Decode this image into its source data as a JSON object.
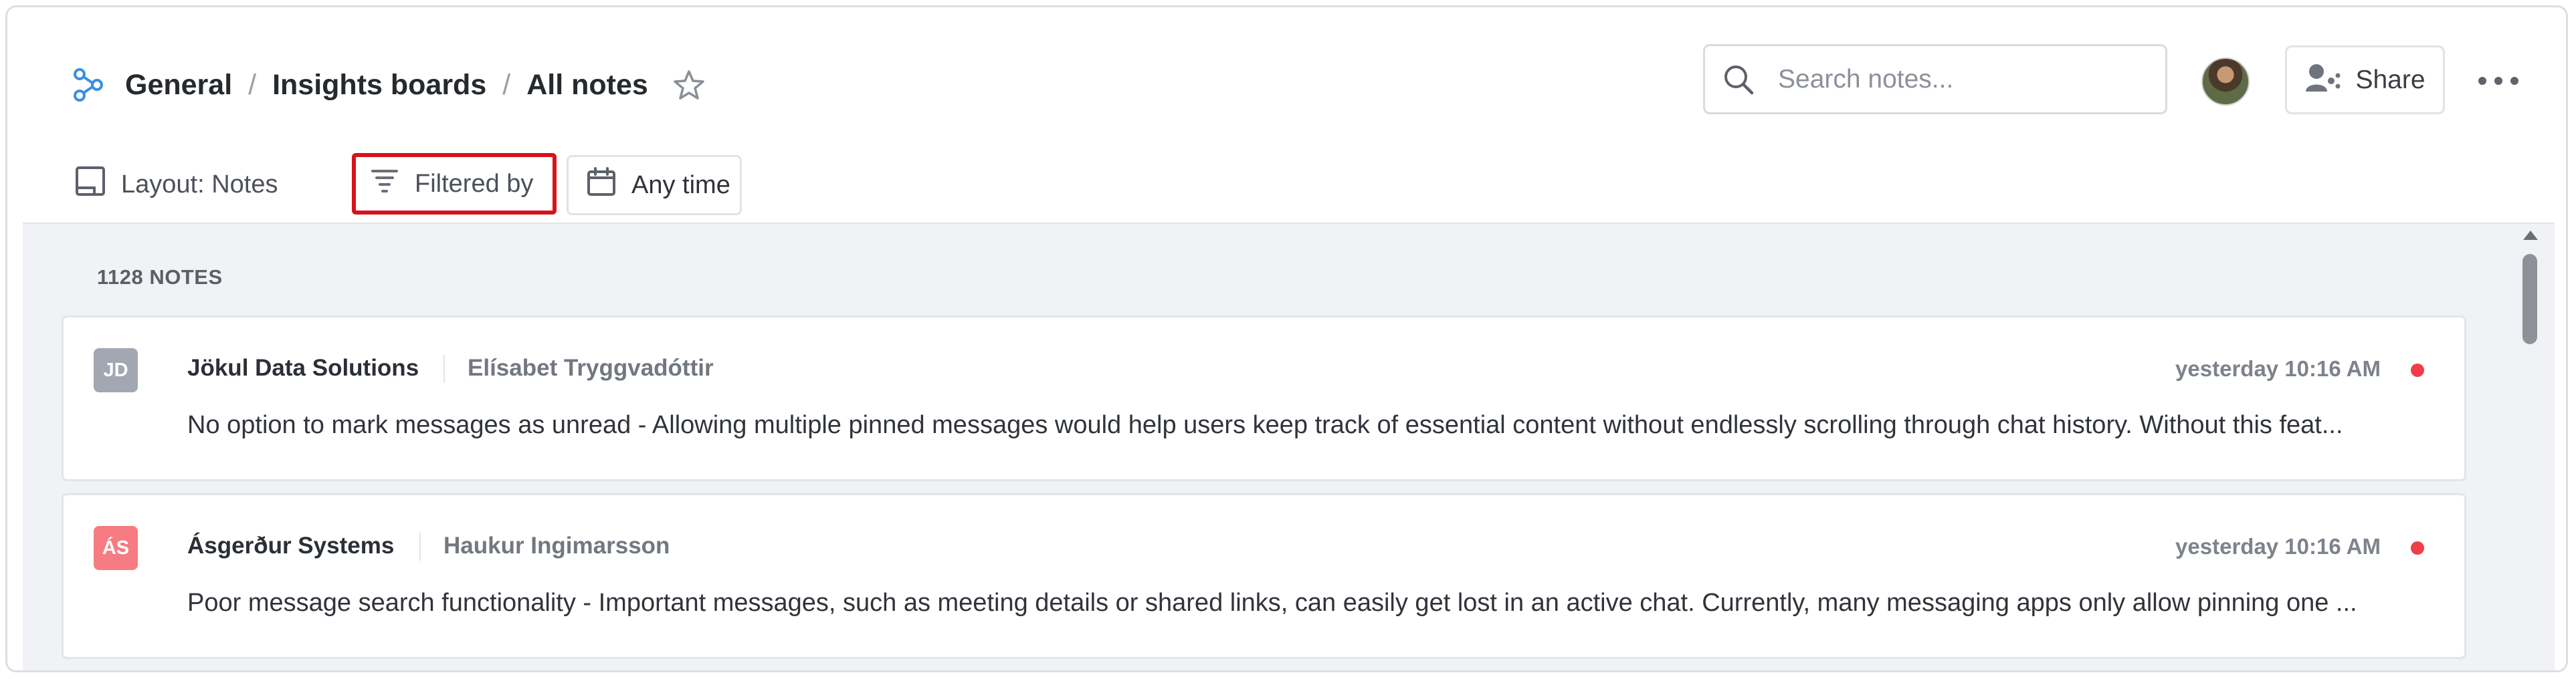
{
  "header": {
    "breadcrumb": [
      "General",
      "Insights boards",
      "All notes"
    ],
    "separator": "/",
    "search_placeholder": "Search notes...",
    "share_label": "Share"
  },
  "toolbar": {
    "layout_label": "Layout: Notes",
    "filter_label": "Filtered by",
    "time_label": "Any time"
  },
  "notes": {
    "count_label": "1128 NOTES",
    "items": [
      {
        "initials": "JD",
        "badge_color": "#a3a7b1",
        "company": "Jökul Data Solutions",
        "person": "Elísabet Tryggvadóttir",
        "time": "yesterday 10:16 AM",
        "text": "No option to mark messages as unread - Allowing multiple pinned messages would help users keep track of essential content without endlessly scrolling through chat history. Without this feat..."
      },
      {
        "initials": "ÁS",
        "badge_color": "#f77b82",
        "company": "Ásgerður Systems",
        "person": "Haukur Ingimarsson",
        "time": "yesterday 10:16 AM",
        "text": "Poor message search functionality - Important messages, such as meeting details or shared links, can easily get lost in an active chat. Currently, many messaging apps only allow pinning one ..."
      }
    ]
  },
  "colors": {
    "accent_logo": "#3b8fe0",
    "filter_highlight": "#d6121a",
    "unread_dot": "#ef3e4a"
  },
  "icons": {
    "logo": "insights-logo-icon",
    "star": "star-icon",
    "search": "search-icon",
    "share": "share-icon",
    "more": "more-dots-icon",
    "layout": "layout-icon",
    "filter": "filter-icon",
    "calendar": "calendar-icon"
  }
}
